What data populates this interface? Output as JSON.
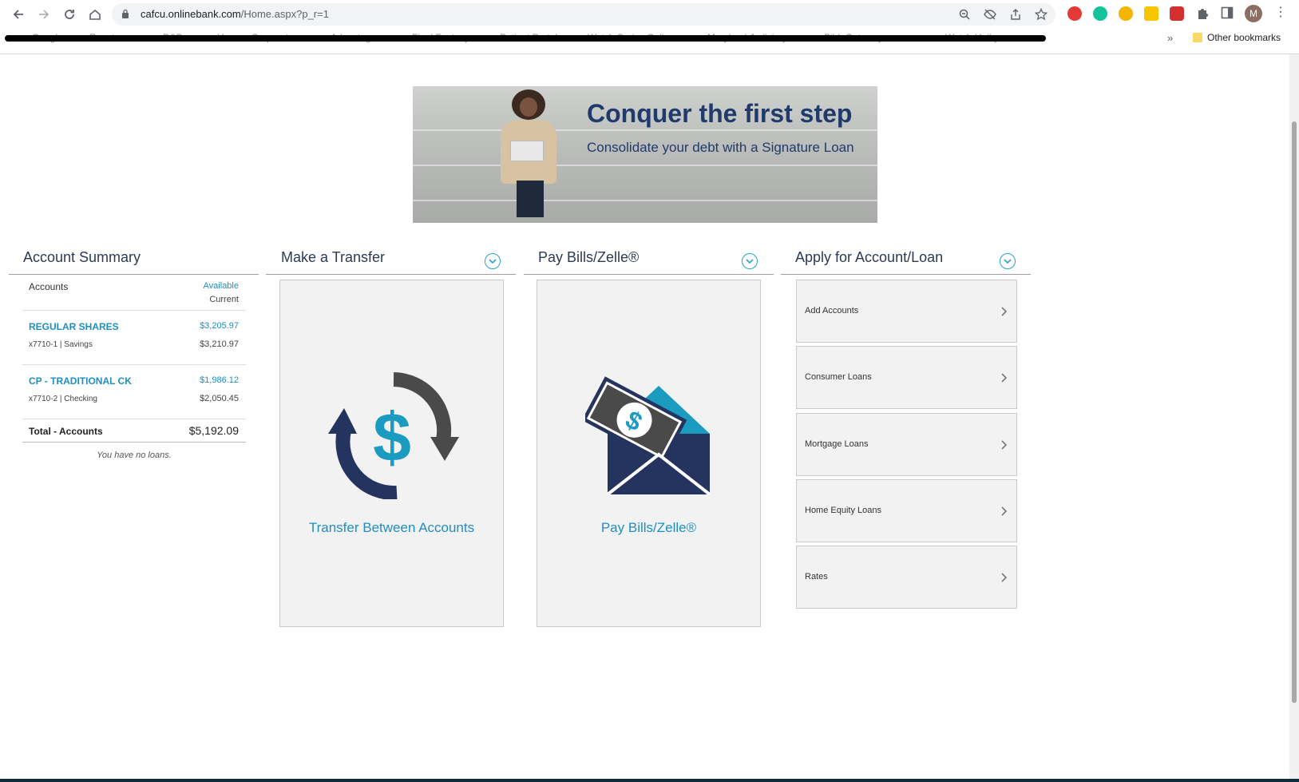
{
  "browser": {
    "url_host": "cafcu.onlinebank.com",
    "url_path": "/Home.aspx?p_r=1",
    "profile_initial": "M",
    "bookmarks": [
      "Google",
      "Revature",
      "D&D",
      "Home - Corporate...",
      "Advantage",
      "Final Fantasy",
      "Patient Portal",
      "Watch Series Online...",
      "Maryland Judiciary...",
      "BibleGateway.com -...",
      "Watch Haikyuu..."
    ],
    "bookmarks_more": "»",
    "other_bookmarks": "Other bookmarks"
  },
  "banner": {
    "title": "Conquer the first step",
    "subtitle": "Consolidate your debt with a Signature Loan"
  },
  "account_summary": {
    "title": "Account Summary",
    "col_accounts": "Accounts",
    "col_available": "Available",
    "col_current": "Current",
    "accounts": [
      {
        "name": "REGULAR SHARES",
        "sub": "x7710-1 | Savings",
        "available": "$3,205.97",
        "current": "$3,210.97"
      },
      {
        "name": "CP - TRADITIONAL CK",
        "sub": "x7710-2 | Checking",
        "available": "$1,986.12",
        "current": "$2,050.45"
      }
    ],
    "total_label": "Total - Accounts",
    "total_value": "$5,192.09",
    "no_loans": "You have no loans."
  },
  "transfer": {
    "title": "Make a Transfer",
    "card_label": "Transfer Between Accounts"
  },
  "bills": {
    "title": "Pay Bills/Zelle®",
    "card_label": "Pay Bills/Zelle®"
  },
  "apply": {
    "title": "Apply for Account/Loan",
    "items": [
      "Add Accounts",
      "Consumer Loans",
      "Mortgage Loans",
      "Home Equity Loans",
      "Rates"
    ]
  },
  "colors": {
    "accent": "#1f8fc1",
    "navy": "#25335f",
    "teal": "#1a9bbf",
    "dark_gray": "#4a4a4a"
  }
}
